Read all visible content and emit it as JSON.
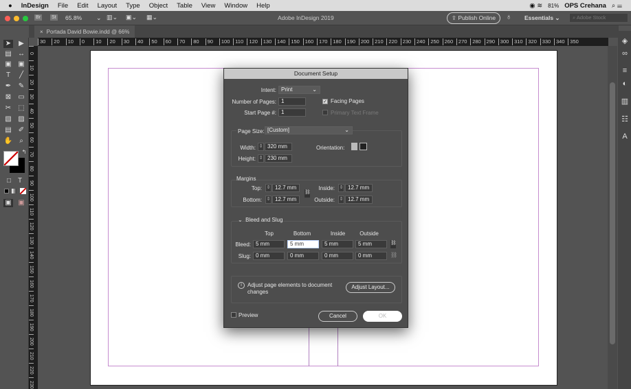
{
  "menubar": {
    "apple": "",
    "app": "InDesign",
    "items": [
      "File",
      "Edit",
      "Layout",
      "Type",
      "Object",
      "Table",
      "View",
      "Window",
      "Help"
    ],
    "battery": "81%",
    "user": "OPS Crehana"
  },
  "appbar": {
    "bridge": "Br",
    "stock": "St",
    "zoom": "65.8%",
    "title": "Adobe InDesign 2019",
    "publish": "Publish Online",
    "workspace": "Essentials",
    "search_placeholder": "Adobe Stock"
  },
  "tab": {
    "close": "×",
    "label": "Portada David Bowie.indd @ 66%"
  },
  "hruler": [
    "30",
    "20",
    "10",
    "0",
    "10",
    "20",
    "30",
    "40",
    "50",
    "60",
    "70",
    "80",
    "90",
    "100",
    "110",
    "120",
    "130",
    "140",
    "150",
    "160",
    "170",
    "180",
    "190",
    "200",
    "210",
    "220",
    "230",
    "240",
    "250",
    "260",
    "270",
    "280",
    "290",
    "300",
    "310",
    "320",
    "330",
    "340",
    "350"
  ],
  "vruler": [
    "0",
    "10",
    "20",
    "30",
    "40",
    "50",
    "60",
    "70",
    "80",
    "90",
    "100",
    "110",
    "120",
    "130",
    "140",
    "150",
    "160",
    "170",
    "180",
    "190",
    "200",
    "210",
    "220",
    "230"
  ],
  "dialog": {
    "title": "Document Setup",
    "intent_label": "Intent:",
    "intent": "Print",
    "pages_label": "Number of Pages:",
    "pages": "1",
    "start_label": "Start Page #:",
    "start": "1",
    "facing": "Facing Pages",
    "primary": "Primary Text Frame",
    "pagesize_label": "Page Size:",
    "pagesize": "[Custom]",
    "width_label": "Width:",
    "width": "320 mm",
    "height_label": "Height:",
    "height": "230 mm",
    "orientation_label": "Orientation:",
    "margins": {
      "title": "Margins",
      "top_label": "Top:",
      "top": "12.7 mm",
      "bottom_label": "Bottom:",
      "bottom": "12.7 mm",
      "inside_label": "Inside:",
      "inside": "12.7 mm",
      "outside_label": "Outside:",
      "outside": "12.7 mm"
    },
    "bleed": {
      "title": "Bleed and Slug",
      "cols": [
        "Top",
        "Bottom",
        "Inside",
        "Outside"
      ],
      "bleed_label": "Bleed:",
      "bleed": [
        "5 mm",
        "5 mm",
        "5 mm",
        "5 mm"
      ],
      "slug_label": "Slug:",
      "slug": [
        "0 mm",
        "0 mm",
        "0 mm",
        "0 mm"
      ]
    },
    "adjust_text": "Adjust page elements to document changes",
    "adjust_btn": "Adjust Layout...",
    "preview": "Preview",
    "cancel": "Cancel",
    "ok": "OK"
  }
}
